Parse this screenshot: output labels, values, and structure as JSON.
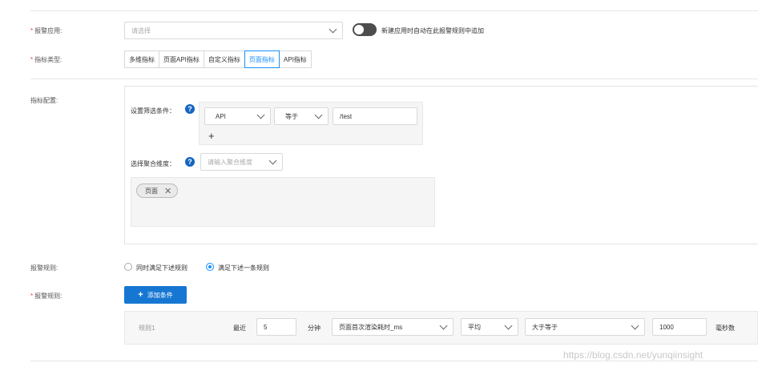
{
  "alert_app": {
    "label": "报警应用:",
    "placeholder": "请选择",
    "toggle_text": "新建应用时自动在此报警规则中追加"
  },
  "metric_type": {
    "label": "指标类型:",
    "tabs": [
      "多维指标",
      "页面API指标",
      "自定义指标",
      "页面指标",
      "API指标"
    ],
    "active_tab": "页面指标"
  },
  "metric_config": {
    "label": "指标配置:",
    "filter_label": "设置筛选条件：",
    "filter": {
      "field": "API",
      "operator": "等于",
      "value": "/test"
    },
    "add_symbol": "+",
    "dimension_label": "选择聚合维度：",
    "dimension_placeholder": "请输入聚合维度",
    "chips": [
      {
        "label": "页面",
        "remove": "✕"
      }
    ],
    "help_symbol": "?"
  },
  "alert_rule_mode": {
    "label": "报警规则:",
    "options": [
      "同时满足下述规则",
      "满足下述一条规则"
    ],
    "selected": "满足下述一条规则"
  },
  "alert_rules": {
    "label": "报警规则:",
    "add_button": "添加条件",
    "add_button_icon": "+",
    "rows": [
      {
        "name": "规则1",
        "recent_label": "最近",
        "minutes": "5",
        "minutes_unit": "分钟",
        "metric": "页面首次渲染耗时_ms",
        "aggregation": "平均",
        "comparator": "大于等于",
        "threshold": "1000",
        "unit": "毫秒数"
      }
    ]
  },
  "required_mark": "*",
  "watermark": "https://blog.csdn.net/yunqiinsight",
  "colors": {
    "primary": "#1677d2",
    "required": "#f04134",
    "toggle": "#4d4d4d",
    "help_icon": "#1565c0",
    "active_tab": "#1890ff"
  }
}
